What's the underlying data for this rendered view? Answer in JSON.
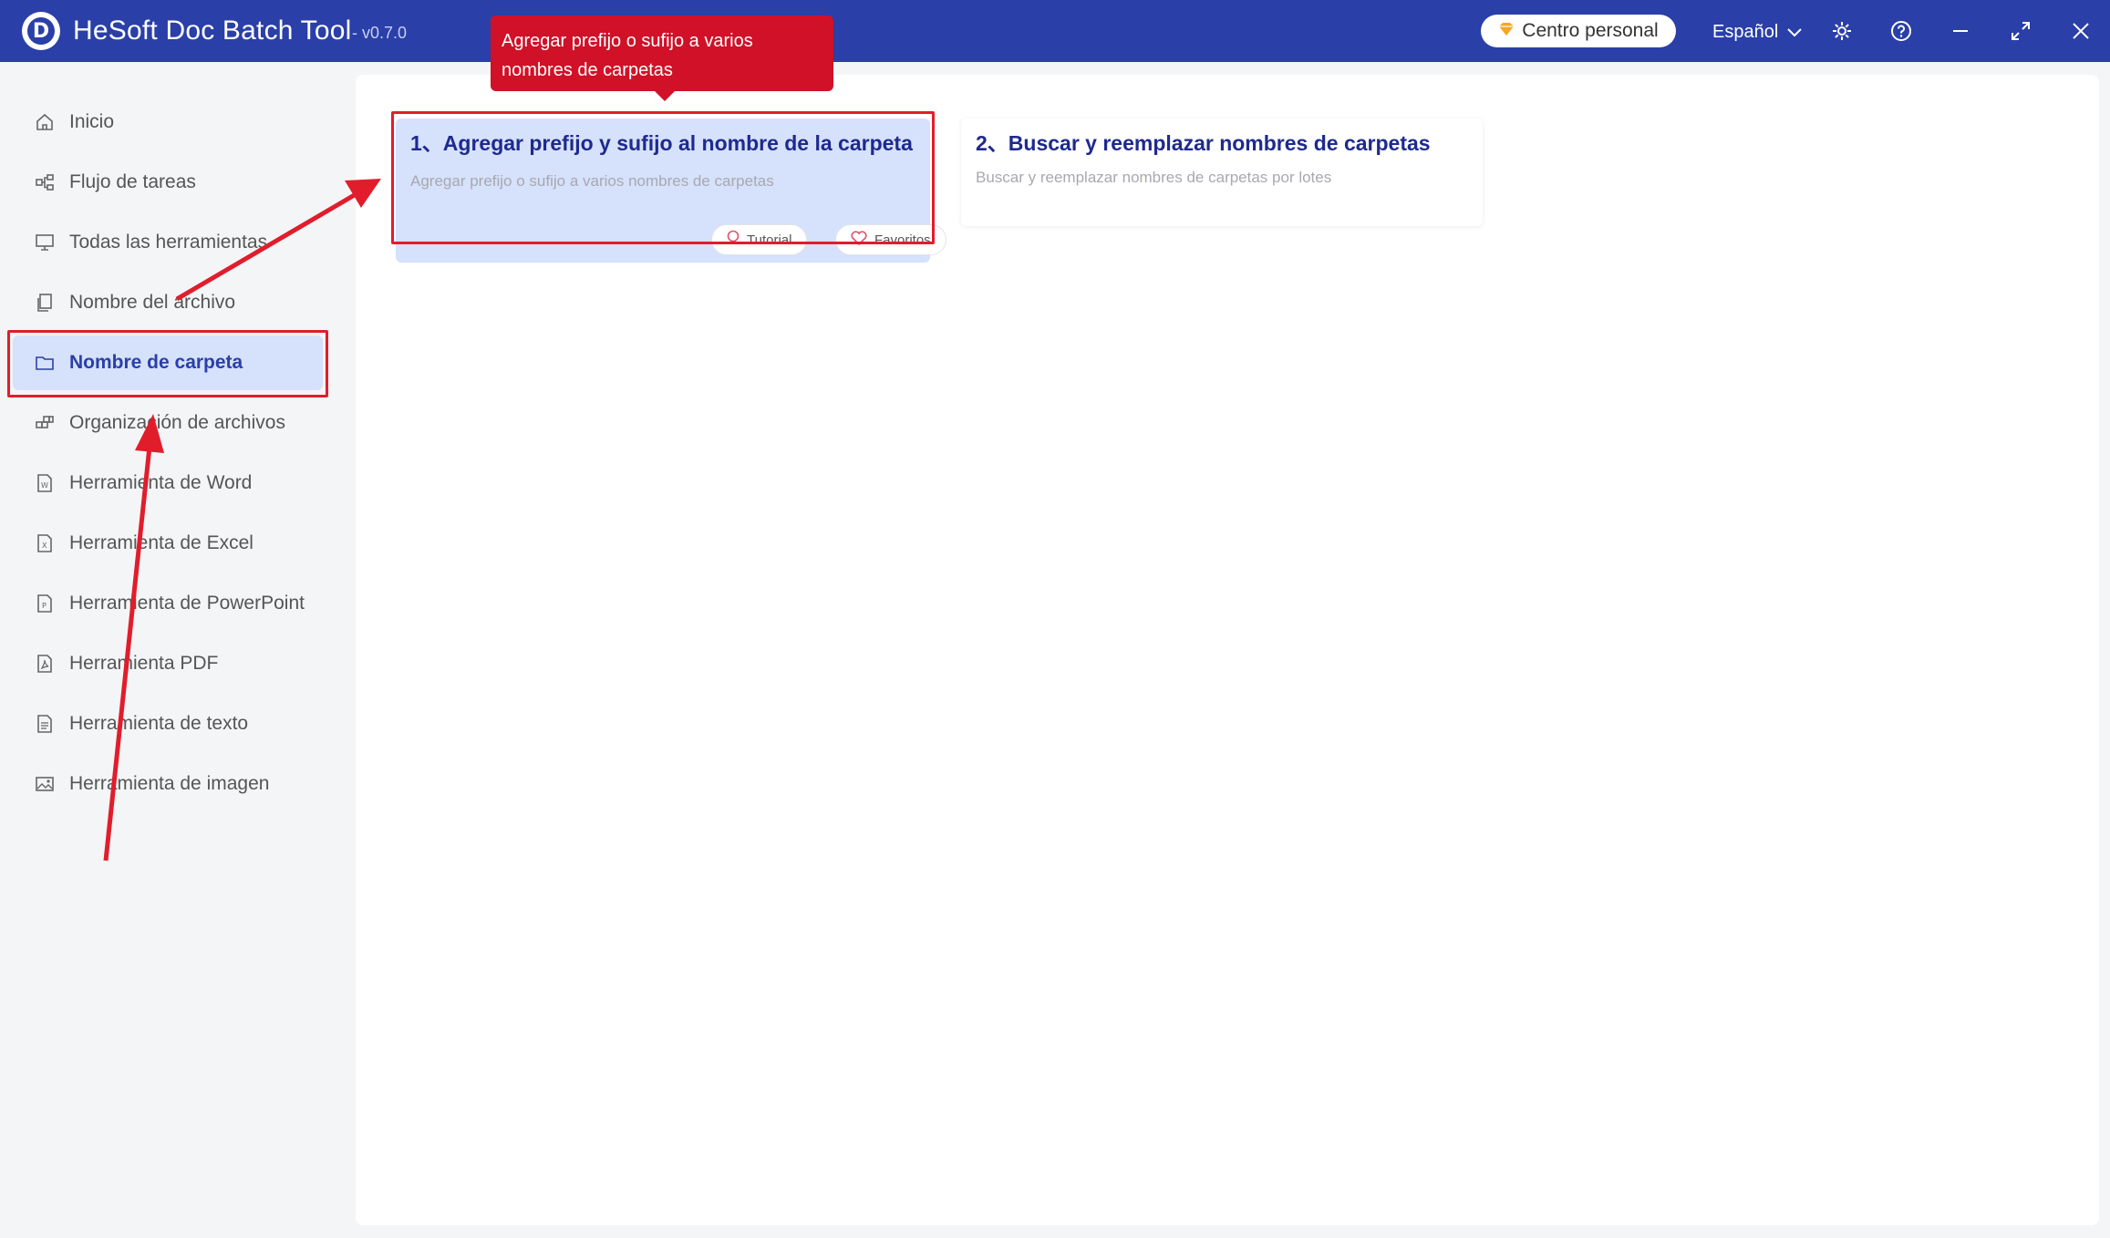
{
  "window": {
    "title": "HeSoft Doc Batch Tool",
    "version": "- v0.7.0",
    "personal_center": "Centro personal",
    "language": "Español",
    "icons": [
      "settings-icon",
      "help-icon",
      "minimize-icon",
      "maximize-icon",
      "close-icon"
    ]
  },
  "sidebar": {
    "items": [
      {
        "label": "Inicio",
        "icon": "home-icon"
      },
      {
        "label": "Flujo de tareas",
        "icon": "workflow-icon"
      },
      {
        "label": "Todas las herramientas",
        "icon": "monitor-icon"
      },
      {
        "label": "Nombre del archivo",
        "icon": "file-copy-icon"
      },
      {
        "label": "Nombre de carpeta",
        "icon": "folder-icon",
        "active": true
      },
      {
        "label": "Organización de archivos",
        "icon": "organize-icon"
      },
      {
        "label": "Herramienta de Word",
        "icon": "word-file-icon"
      },
      {
        "label": "Herramienta de Excel",
        "icon": "excel-file-icon"
      },
      {
        "label": "Herramienta de PowerPoint",
        "icon": "powerpoint-file-icon"
      },
      {
        "label": "Herramienta PDF",
        "icon": "pdf-file-icon"
      },
      {
        "label": "Herramienta de texto",
        "icon": "text-file-icon"
      },
      {
        "label": "Herramienta de imagen",
        "icon": "image-icon"
      }
    ]
  },
  "tools": [
    {
      "title": "1、Agregar prefijo y sufijo al nombre de la carpeta",
      "description": "Agregar prefijo o sufijo a varios nombres de carpetas",
      "tutorial": "Tutorial",
      "favorites": "Favoritos"
    },
    {
      "title": "2、Buscar y reemplazar nombres de carpetas",
      "description": "Buscar y reemplazar nombres de carpetas por lotes"
    }
  ],
  "tooltip": {
    "text": "Agregar prefijo o sufijo a varios nombres de carpetas"
  },
  "colors": {
    "titlebar": "#2a3fa8",
    "active_bg": "#d6e1fb",
    "card_title": "#1e2a8e",
    "annotation_red": "#e11d2c",
    "tooltip_bg": "#d01127"
  }
}
